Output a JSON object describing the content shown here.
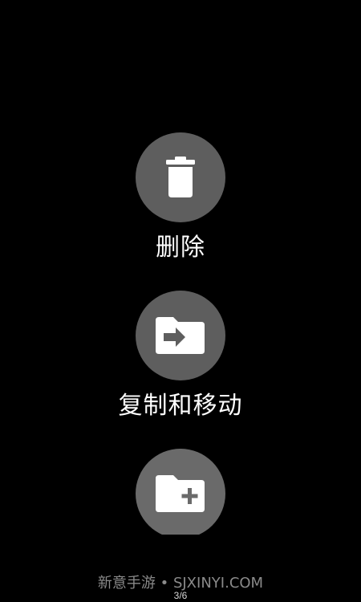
{
  "actions": [
    {
      "id": "delete",
      "label": "删除",
      "icon": "trash-icon"
    },
    {
      "id": "copy_move",
      "label": "复制和移动",
      "icon": "folder-move-icon"
    },
    {
      "id": "new_folder",
      "label": "",
      "icon": "folder-add-icon"
    }
  ],
  "colors": {
    "background": "#000000",
    "circle": "#5e5e5e",
    "icon": "#ffffff",
    "label": "#ffffff",
    "watermark": "#8a8a8a"
  },
  "watermark": "新意手游 • SJXINYI.COM",
  "page_indicator": "3/6"
}
